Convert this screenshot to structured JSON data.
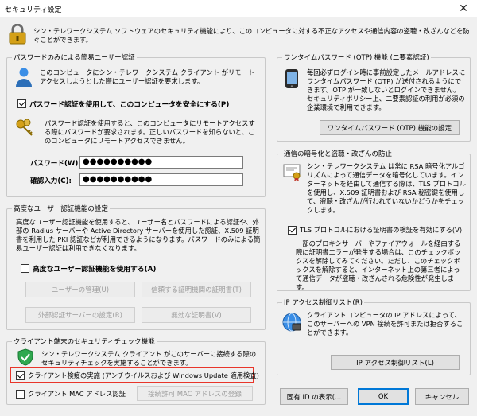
{
  "window": {
    "title": "セキュリティ設定",
    "close": "✕"
  },
  "header": {
    "description": "シン・テレワークシステム ソフトウェアのセキュリティ機能により、このコンピュータに対する不正なアクセスや通信内容の盗聴・改ざんなどを防ぐことができます。"
  },
  "simple_auth": {
    "legend": "パスワードのみによる簡易ユーザー認証",
    "description": "このコンピュータにシン・テレワークシステム クライアント がリモートアクセスしようとした際にユーザー認証を要求します。",
    "checkbox_label": "パスワード認証を使用して、このコンピュータを安全にする(P)",
    "checkbox_checked": true,
    "note": "パスワード認証を使用すると、このコンピュータにリモートアクセスする際にパスワードが要求されます。正しいパスワードを知らないと、このコンピュータにリモートアクセスできません。",
    "password_label": "パスワード(W):",
    "password_value": "●●●●●●●●●●",
    "confirm_label": "確認入力(C):",
    "confirm_value": "●●●●●●●●●●"
  },
  "advanced_auth": {
    "legend": "高度なユーザー認証機能の設定",
    "description": "高度なユーザー認証機能を使用すると、ユーザー名とパスワードによる認証や、外部の Radius サーバーや Active Directory サーバーを使用した認証、X.509 証明書を利用した PKI 認証などが利用できるようになります。パスワードのみによる簡易ユーザー認証は利用できなくなります。",
    "checkbox_label": "高度なユーザー認証機能を使用する(A)",
    "checkbox_checked": false,
    "user_mgmt": "ユーザーの管理(U)",
    "trusted_ca": "信頼する証明機関の証明書(T)",
    "external_auth": "外部認証サーバーの設定(R)",
    "revoked_cert": "無効な証明書(V)"
  },
  "client_check": {
    "legend": "クライアント端末のセキュリティチェック機能",
    "description": "シン・テレワークシステム クライアント がこのサーバーに接続する際のセキュリティチェックを実施することができます。",
    "inspection_label": "クライアント検疫の実施 (アンチウイルスおよび Windows Update 適用検査)",
    "inspection_checked": true,
    "mac_label": "クライアント MAC アドレス認証",
    "mac_checked": false,
    "mac_button": "接続許可 MAC アドレスの登録"
  },
  "otp": {
    "legend": "ワンタイムパスワード (OTP) 機能 (二要素認証)",
    "description": "毎回必ずログイン時に事前設定したメールアドレスにワンタイムパスワード (OTP) が送付されるようにできます。OTP が一致しないとログインできません。セキュリティポリシー上、二要素認証の利用が必須の企業環境で利用できます。",
    "button": "ワンタイムパスワード (OTP) 機能の設定"
  },
  "encryption": {
    "legend": "通信の暗号化と盗聴・改ざんの防止",
    "description": "シン・テレワークシステム は常に RSA 暗号化アルゴリズムによって通信データを暗号化しています。インターネットを経由して通信する際は、TLS プロトコルを使用し、X.509 証明書および RSA 秘密鍵を使用して、盗聴・改ざんが行われていないかどうかをチェックします。",
    "checkbox_label": "TLS プロトコルにおける証明書の検証を有効にする(V)",
    "checkbox_checked": true,
    "note": "一部のプロキシサーバーやファイアウォールを経由する際に証明書エラーが発生する場合は、このチェックボックスを解除してみてください。ただし、このチェックボックスを解除すると、インターネット上の第三者によって通信データが盗聴・改ざんされる危険性が発生します。"
  },
  "ip_limit": {
    "legend": "IP アクセス制御リスト(R)",
    "description": "クライアントコンピュータの IP アドレスによって、このサーバーへの VPN 接続を許可または拒否することができます。",
    "button": "IP アクセス制御リスト(L)"
  },
  "footer": {
    "unique_id": "固有 ID の表示(...",
    "ok": "OK",
    "cancel": "キャンセル"
  },
  "colors": {
    "highlight": "#e8352a",
    "accent": "#0078d7"
  }
}
